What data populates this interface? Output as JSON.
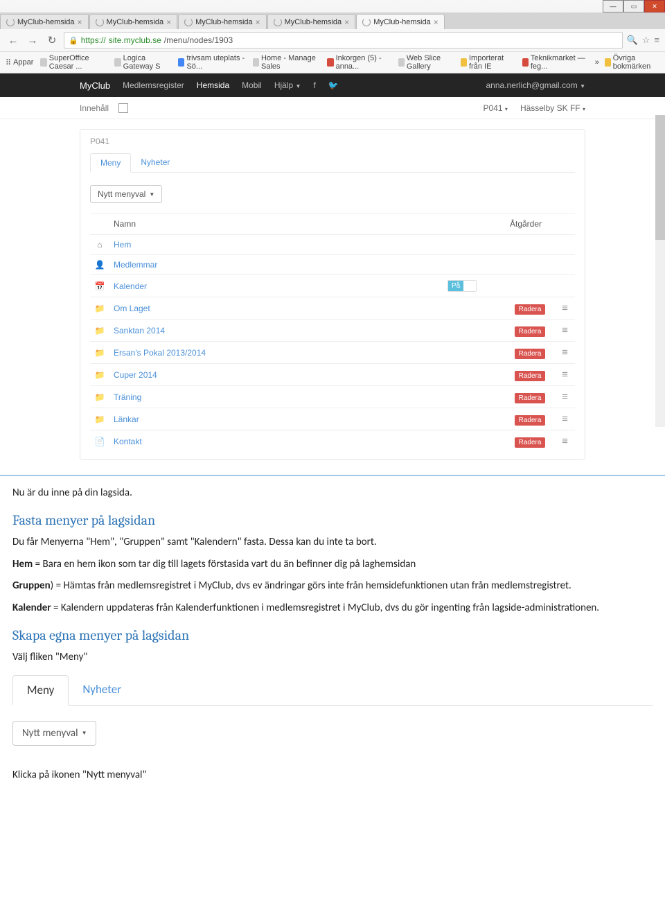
{
  "browser": {
    "tabs": [
      {
        "title": "MyClub-hemsida"
      },
      {
        "title": "MyClub-hemsida"
      },
      {
        "title": "MyClub-hemsida"
      },
      {
        "title": "MyClub-hemsida"
      },
      {
        "title": "MyClub-hemsida"
      }
    ],
    "url_https": "https://",
    "url_host": "site.myclub.se",
    "url_path": "/menu/nodes/1903",
    "bookmarks": {
      "label_apps": "Appar",
      "items": [
        "SuperOffice Caesar ...",
        "Logica Gateway S",
        "trivsam uteplats - Sö...",
        "Home - Manage Sales",
        "Inkorgen (5) - anna...",
        "Web Slice Gallery",
        "Importerat från IE",
        "Teknikmarket — feg..."
      ],
      "more": "»",
      "other": "Övriga bokmärken"
    }
  },
  "app": {
    "brand": "MyClub",
    "nav": [
      "Medlemsregister",
      "Hemsida",
      "Mobil",
      "Hjälp"
    ],
    "user": "anna.nerlich@gmail.com",
    "subnav_left": "Innehåll",
    "subnav_right": [
      "P041",
      "Hässelby SK FF"
    ],
    "page_label": "P041",
    "tabs": {
      "meny": "Meny",
      "nyheter": "Nyheter"
    },
    "new_btn": "Nytt menyval",
    "table": {
      "col_name": "Namn",
      "col_actions": "Åtgårder",
      "rows": [
        {
          "icon": "home",
          "name": "Hem",
          "toggle": false,
          "delete": false,
          "drag": false
        },
        {
          "icon": "user",
          "name": "Medlemmar",
          "toggle": false,
          "delete": false,
          "drag": false
        },
        {
          "icon": "calendar",
          "name": "Kalender",
          "toggle": true,
          "toggle_label": "På",
          "delete": false,
          "drag": false
        },
        {
          "icon": "folder",
          "name": "Om Laget",
          "toggle": false,
          "delete": true,
          "drag": true
        },
        {
          "icon": "folder",
          "name": "Sanktan 2014",
          "toggle": false,
          "delete": true,
          "drag": true
        },
        {
          "icon": "folder",
          "name": "Ersan's Pokal 2013/2014",
          "toggle": false,
          "delete": true,
          "drag": true
        },
        {
          "icon": "folder",
          "name": "Cuper 2014",
          "toggle": false,
          "delete": true,
          "drag": true
        },
        {
          "icon": "folder",
          "name": "Träning",
          "toggle": false,
          "delete": true,
          "drag": true
        },
        {
          "icon": "folder",
          "name": "Länkar",
          "toggle": false,
          "delete": true,
          "drag": true
        },
        {
          "icon": "file",
          "name": "Kontakt",
          "toggle": false,
          "delete": true,
          "drag": true
        }
      ],
      "delete_label": "Radera"
    }
  },
  "doc": {
    "p1": "Nu är du inne på din lagsida.",
    "h1": "Fasta menyer på lagsidan",
    "p2": "Du får Menyerna \"Hem\", \"Gruppen\" samt \"Kalendern\" fasta. Dessa kan du inte ta bort.",
    "p3_b": "Hem",
    "p3": " = Bara en hem ikon som tar dig till lagets förstasida vart du än befinner dig på laghemsidan",
    "p4_b": "Gruppen",
    "p4": ") = Hämtas från medlemsregistret i MyClub, dvs ev ändringar görs inte från hemsidefunktionen utan från medlemstregistret.",
    "p5_b": "Kalender",
    "p5": " = Kalendern uppdateras från Kalenderfunktionen i medlemsregistret i MyClub, dvs du gör ingenting från lagside-administrationen.",
    "h2": "Skapa egna menyer på lagsidan",
    "p6": "Välj fliken \"Meny\"",
    "p7": "Klicka på ikonen \"Nytt menyval\""
  },
  "inset": {
    "tab1": "Meny",
    "tab2": "Nyheter",
    "btn": "Nytt menyval"
  },
  "icons": {
    "home": "⌂",
    "user": "👤",
    "calendar": "📅",
    "folder": "📁",
    "file": "📄"
  }
}
